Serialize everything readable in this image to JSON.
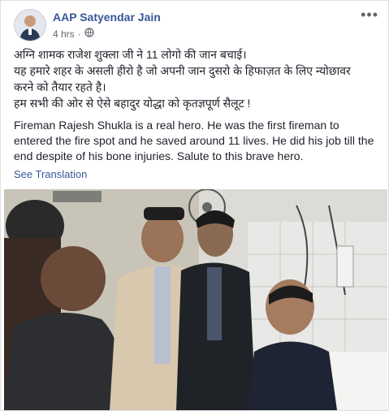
{
  "post": {
    "author": "AAP Satyendar Jain",
    "time": "4 hrs",
    "privacy_icon": "globe-icon",
    "more_icon": "ellipsis-icon",
    "hindi_lines": [
      "अग्नि शामक राजेश शुक्ला जी ने 11 लोगो की जान बचाई।",
      "यह हमारे शहर के असली हीरो है जो अपनी जान दुसरो के हिफाज़त के लिए न्योछावर",
      "करने को तैयार रहते है।",
      "हम सभी की ओर से ऐसे बहादुर योद्धा को कृतज्ञपूर्ण सैलूट !"
    ],
    "english_text": "Fireman Rajesh Shukla is a real hero. He was the first fireman to entered the fire spot and he saved around 11 lives. He did his job till the end despite of his bone injuries. Salute to this brave hero.",
    "see_translation": "See Translation",
    "colors": {
      "link": "#385898",
      "text": "#1d2129",
      "meta": "#616770"
    }
  }
}
